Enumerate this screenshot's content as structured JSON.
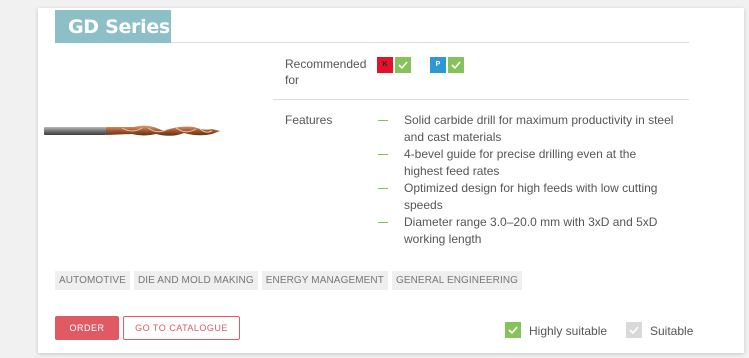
{
  "product": {
    "series_title": "GD Series",
    "recommended_label": "Recommended for",
    "features_label": "Features",
    "materials": [
      {
        "code": "K",
        "color": "#e3112c",
        "suitability": "highly-suitable"
      },
      {
        "code": "P",
        "color": "#2d97d8",
        "suitability": "highly-suitable"
      }
    ],
    "features": [
      "Solid carbide drill for maximum productivity in steel and cast materials",
      "4-bevel guide for precise drilling even at the highest feed rates",
      "Optimized design for high feeds with low cutting speeds",
      "Diameter range 3.0–20.0 mm with 3xD and 5xD working length"
    ],
    "image_icon": "drill-bit-image"
  },
  "tags": [
    "AUTOMOTIVE",
    "DIE AND MOLD MAKING",
    "ENERGY MANAGEMENT",
    "GENERAL ENGINEERING"
  ],
  "actions": {
    "order_label": "ORDER",
    "catalogue_label": "GO TO CATALOGUE"
  },
  "legend": {
    "highly_suitable": "Highly suitable",
    "suitable": "Suitable"
  },
  "colors": {
    "accent_teal": "#8dbfc6",
    "check_green": "#86c25a",
    "button_red": "#e05a63",
    "suitable_gray": "#d9d9d9"
  }
}
